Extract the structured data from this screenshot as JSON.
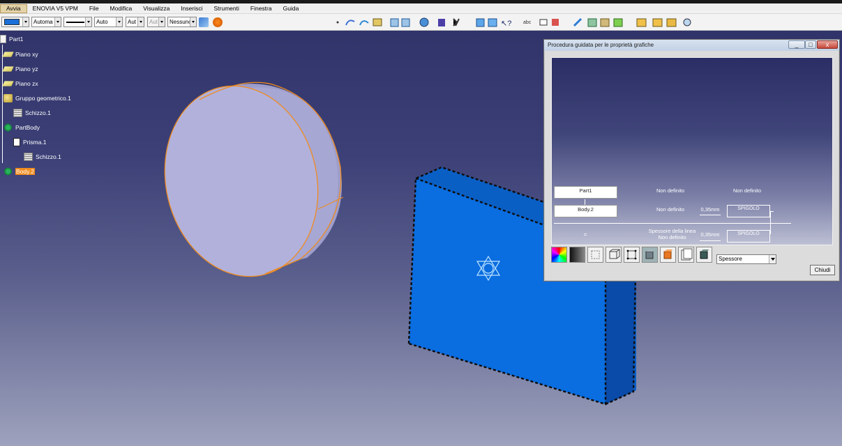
{
  "menu": {
    "items": [
      "Avvia",
      "ENOVIA V5 VPM",
      "File",
      "Modifica",
      "Visualizza",
      "Inserisci",
      "Strumenti",
      "Finestra",
      "Guida"
    ]
  },
  "toolbar": {
    "color_combo": "",
    "transparency_combo": "Automa",
    "line_combo": "",
    "line_weight_combo": "Auto",
    "line_type_combo": "Aut",
    "point_combo": "Aut",
    "layer_combo": "Nessuno"
  },
  "tree": {
    "root": "Part1",
    "plane_xy": "Piano xy",
    "plane_yz": "Piano yz",
    "plane_zx": "Piano zx",
    "geo_set": "Gruppo geometrico.1",
    "sketch1": "Schizzo.1",
    "partbody": "PartBody",
    "prism": "Prisma.1",
    "sketch1b": "Schizzo.1",
    "body2": "Body.2"
  },
  "dialog": {
    "title": "Procedura guidata per le proprietà grafiche",
    "min": "_",
    "max": "□",
    "close": "x",
    "part_label": "Part1",
    "body_label": "Body.2",
    "nd1": "Non definito",
    "nd2": "Non definito",
    "nd3": "Non definito",
    "thick1": "0,35mm",
    "edge1": "SPIGOLO",
    "equals": "=",
    "line_thickness_label": "Spessore della linea",
    "nd4": "Non definito",
    "thick2": "0,35mm",
    "edge2": "SPIGOLO",
    "property_select": "Spessore",
    "close_button": "Chiudi"
  },
  "colors": {
    "body_blue": "#0a6de0",
    "selection_orange": "#f08b1d",
    "cylinder": "#b1b1dc"
  }
}
